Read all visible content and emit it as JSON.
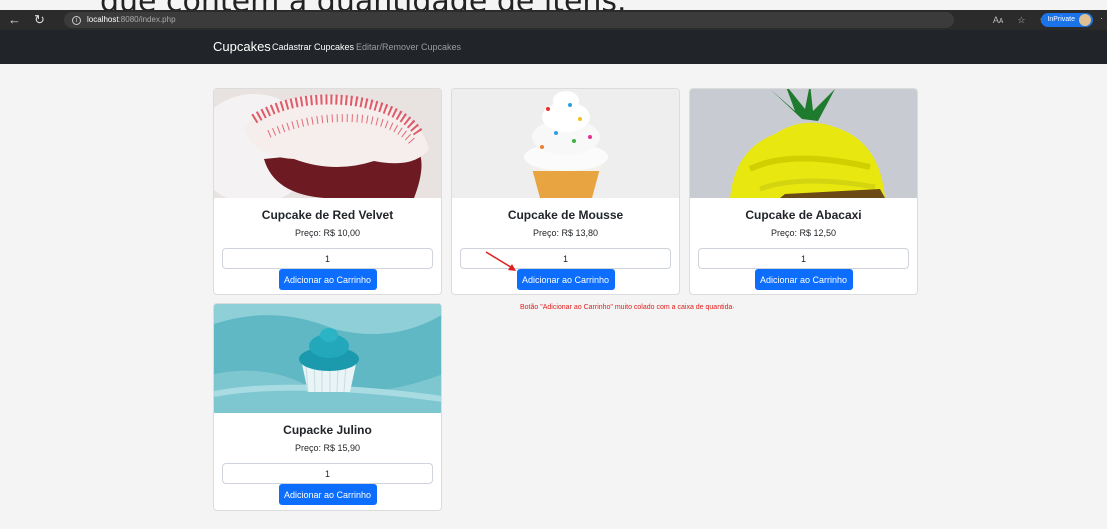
{
  "overlay_caption": "que contém a quantidade de itens.",
  "browser": {
    "back_icon": "←",
    "reload_icon": "↻",
    "info_icon": "i",
    "url_host": "localhost",
    "url_path": ":8080/index.php",
    "read_aloud": "Aᴀ",
    "favorite_icon": "☆",
    "favorites_icon": "✩",
    "inprivate_label": "InPrivate",
    "more_icon": "·"
  },
  "navbar": {
    "brand": "Cupcakes",
    "links": [
      {
        "label": "Cadastrar Cupcakes",
        "active": true
      },
      {
        "label": "Editar/Remover Cupcakes",
        "active": false
      }
    ]
  },
  "products": [
    {
      "name": "Cupcake de Red Velvet",
      "price": "Preço: R$ 10,00",
      "quantity": "1",
      "button": "Adicionar ao Carrinho",
      "image": "red-velvet-cupcake"
    },
    {
      "name": "Cupcake de Mousse",
      "price": "Preço: R$ 13,80",
      "quantity": "1",
      "button": "Adicionar ao Carrinho",
      "image": "mousse-cupcake"
    },
    {
      "name": "Cupcake de Abacaxi",
      "price": "Preço: R$ 12,50",
      "quantity": "1",
      "button": "Adicionar ao Carrinho",
      "image": "pineapple-cupcake"
    },
    {
      "name": "Cupacke Julino",
      "price": "Preço: R$ 15,90",
      "quantity": "1",
      "button": "Adicionar ao Carrinho",
      "image": "blue-cupcake"
    }
  ],
  "annotation": "Botão \"Adicionar ao Carrinho\" muito colado com a caixa de quantida·",
  "colors": {
    "primary": "#0d6efd",
    "navbar": "#212529",
    "annotation": "#e02020"
  }
}
